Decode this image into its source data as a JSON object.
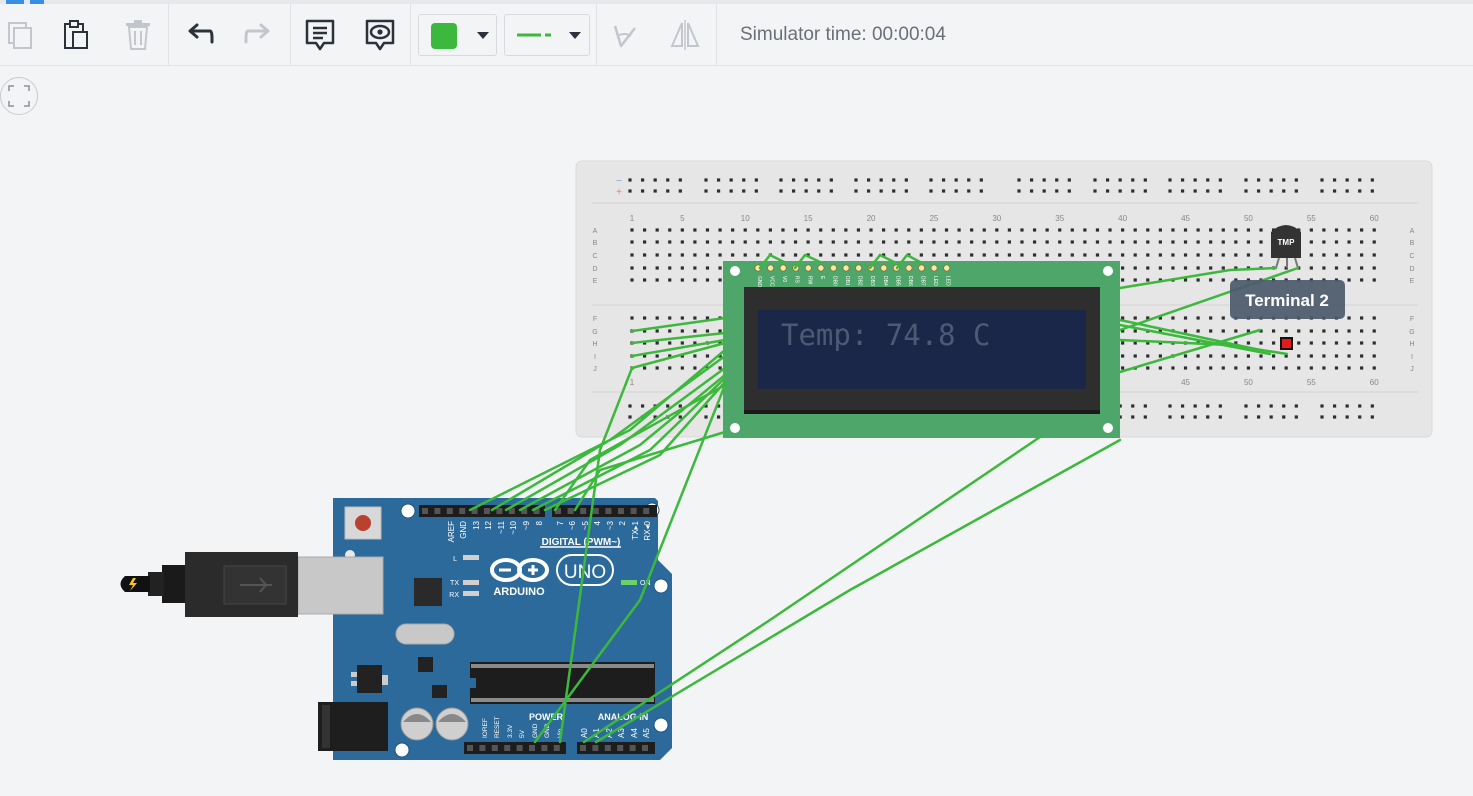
{
  "toolbar": {
    "buttons": [
      {
        "name": "copy-button",
        "enabled": false
      },
      {
        "name": "paste-button",
        "enabled": true
      },
      {
        "name": "delete-button",
        "enabled": false
      },
      {
        "name": "undo-button",
        "enabled": true
      },
      {
        "name": "redo-button",
        "enabled": false
      },
      {
        "name": "notes-button",
        "enabled": true
      },
      {
        "name": "toggle-notes-visibility-button",
        "enabled": true
      },
      {
        "name": "wire-color-dropdown",
        "enabled": true
      },
      {
        "name": "wire-type-dropdown",
        "enabled": true
      },
      {
        "name": "rotate-button",
        "enabled": false
      },
      {
        "name": "flip-button",
        "enabled": false
      }
    ],
    "wire_color": "#3cb83c",
    "sim_time": "Simulator time: 00:00:04"
  },
  "breadboard": {
    "column_numbers": [
      "1",
      "5",
      "10",
      "15",
      "20",
      "25",
      "30",
      "35",
      "40",
      "45",
      "50",
      "55",
      "60"
    ],
    "bottom_column_numbers": [
      "1",
      "45",
      "50",
      "55",
      "60"
    ],
    "row_letters_top": [
      "A",
      "B",
      "C",
      "D",
      "E"
    ],
    "row_letters_bottom": [
      "F",
      "G",
      "H",
      "I",
      "J"
    ],
    "rail_signs": [
      "−",
      "+"
    ]
  },
  "lcd": {
    "display_text": "Temp: 74.8 C",
    "pin_labels": [
      "GND",
      "VCC",
      "V0",
      "RS",
      "RW",
      "E",
      "DB0",
      "DB1",
      "DB2",
      "DB3",
      "DB4",
      "DB5",
      "DB6",
      "DB7",
      "LED",
      "LED"
    ]
  },
  "sensor": {
    "label": "TMP"
  },
  "tooltip": {
    "text": "Terminal 2"
  },
  "arduino": {
    "brand": "ARDUINO",
    "model": "UNO",
    "digital_header_label": "DIGITAL (PWM~)",
    "digital_pins": [
      "AREF",
      "GND",
      "13",
      "12",
      "~11",
      "~10",
      "~9",
      "8",
      "7",
      "~6",
      "~5",
      "4",
      "~3",
      "2",
      "TX▸1",
      "RX◂0"
    ],
    "led_labels": [
      "L",
      "TX",
      "RX",
      "ON"
    ],
    "power_label": "POWER",
    "analog_label": "ANALOG IN",
    "power_pins": [
      "IOREF",
      "RESET",
      "3.3V",
      "5V",
      "GND",
      "GND",
      "Vin"
    ],
    "analog_pins": [
      "A0",
      "A1",
      "A2",
      "A3",
      "A4",
      "A5"
    ]
  },
  "colors": {
    "wire": "#3cb83c",
    "arduino_board": "#2c6a9b",
    "lcd_pcb": "#4fa66a",
    "lcd_screen": "#1b2748",
    "lcd_text": "#4e5a75",
    "breadboard": "#e6e6e6",
    "tooltip_bg": "#4b5a6b",
    "probe": "#e21b1b"
  }
}
